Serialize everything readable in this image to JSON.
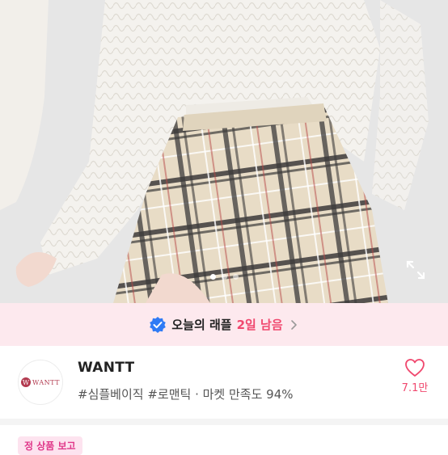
{
  "raffle": {
    "text": "오늘의 래플",
    "remaining": "2일 남음"
  },
  "shop": {
    "name": "WANTT",
    "tags": "#심플베이직 #로맨틱 · 마켓 만족도 94%",
    "logo_text": "WANTT",
    "likes": "7.1만"
  },
  "carousel": {
    "total": 3,
    "active": 1
  },
  "badge": {
    "label": "정 상품 보고"
  },
  "colors": {
    "accent": "#f0486e",
    "raffle_bg": "#fde9ee",
    "verified": "#2f7bf5",
    "badge": "#e0388a"
  }
}
